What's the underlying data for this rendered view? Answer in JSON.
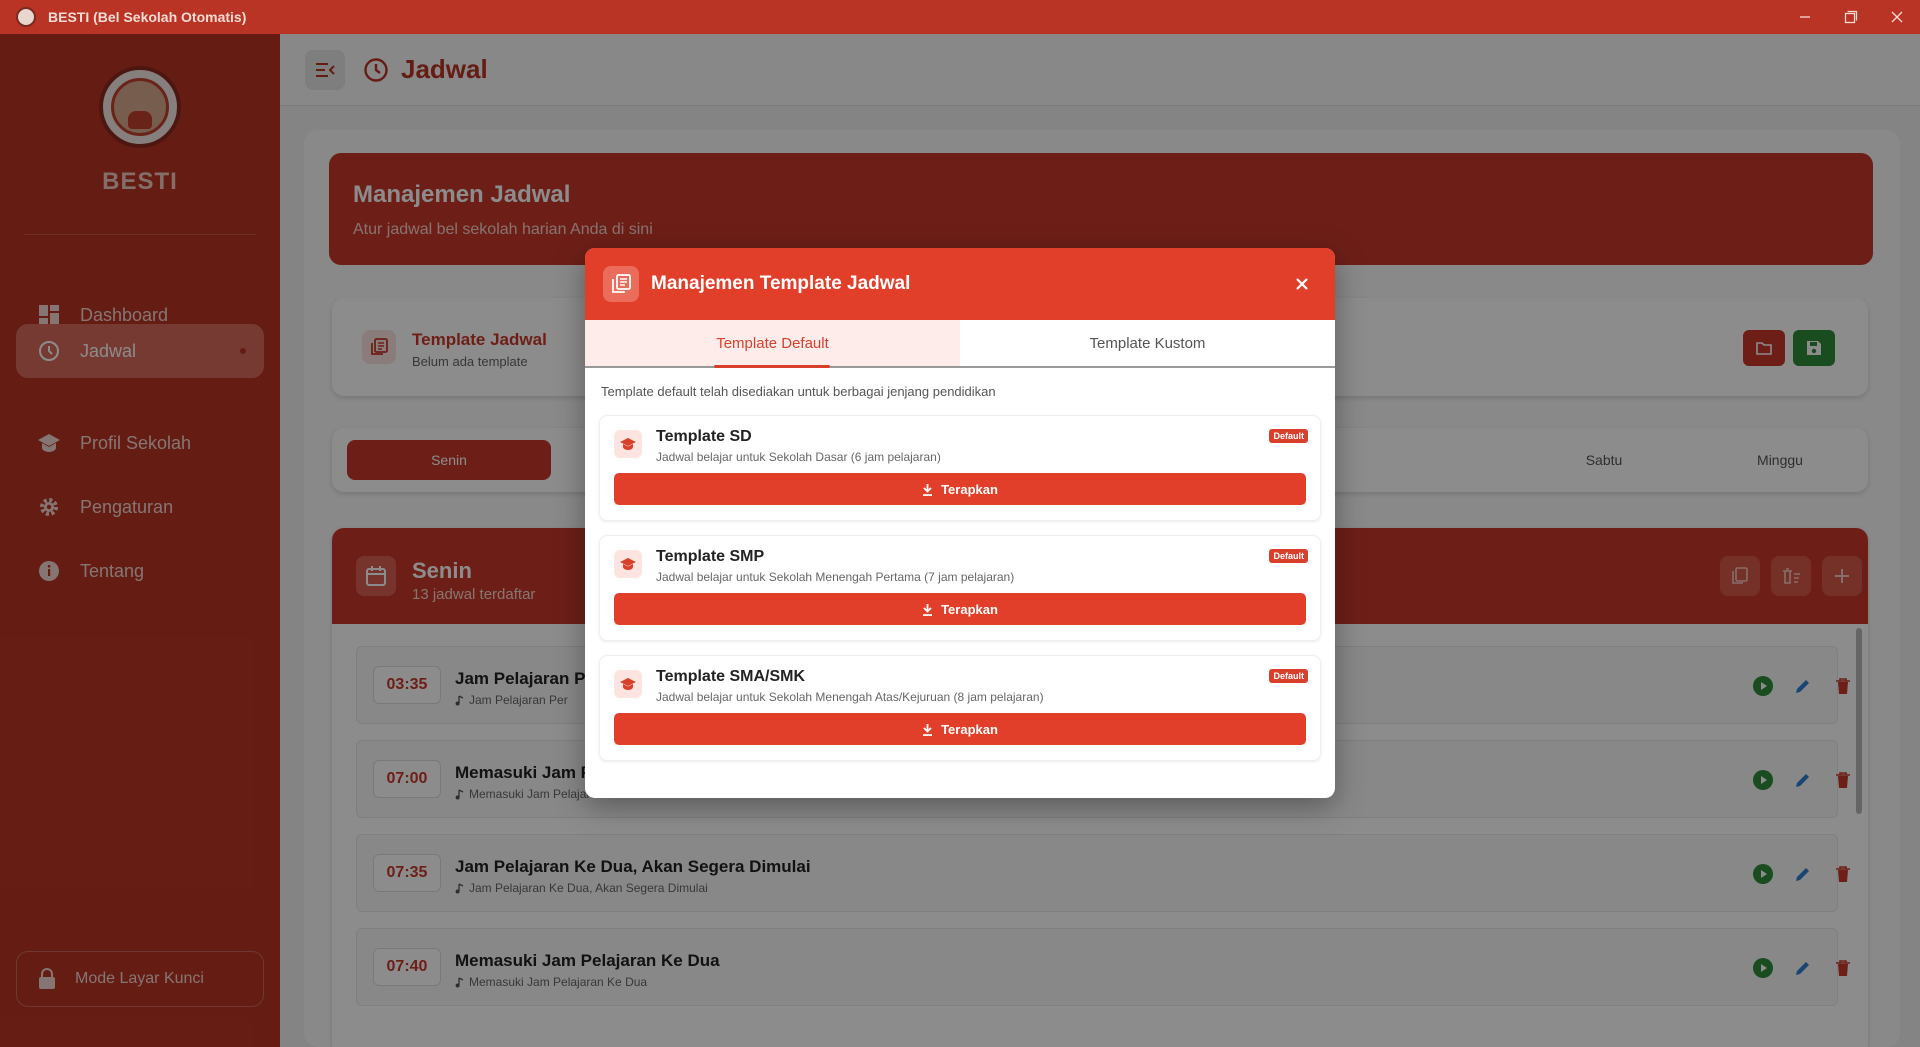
{
  "window": {
    "title": "BESTI (Bel Sekolah Otomatis)"
  },
  "sidebar": {
    "brand": "BESTI",
    "items": [
      {
        "label": "Dashboard",
        "icon": "dashboard-icon"
      },
      {
        "label": "Jadwal",
        "icon": "clock-icon",
        "active": true
      },
      {
        "label": "Profil Sekolah",
        "icon": "school-icon"
      },
      {
        "label": "Pengaturan",
        "icon": "gear-icon"
      },
      {
        "label": "Tentang",
        "icon": "info-icon"
      }
    ],
    "lock_label": "Mode Layar Kunci"
  },
  "topbar": {
    "title": "Jadwal"
  },
  "hero": {
    "title": "Manajemen Jadwal",
    "subtitle": "Atur jadwal bel sekolah harian Anda di sini"
  },
  "template_card": {
    "title": "Template Jadwal",
    "subtitle": "Belum ada template"
  },
  "days": {
    "items": [
      "Senin",
      "Sabtu",
      "Minggu"
    ],
    "active": "Senin"
  },
  "schedule": {
    "day": "Senin",
    "count_label": "13 jadwal terdaftar",
    "rows": [
      {
        "time": "03:35",
        "title": "Jam Pelajaran Pe",
        "subtitle": "Jam Pelajaran Per"
      },
      {
        "time": "07:00",
        "title": "Memasuki Jam P",
        "subtitle": "Memasuki Jam Pelajaran Pertama"
      },
      {
        "time": "07:35",
        "title": "Jam Pelajaran Ke Dua, Akan Segera Dimulai",
        "subtitle": "Jam Pelajaran Ke Dua, Akan Segera Dimulai"
      },
      {
        "time": "07:40",
        "title": "Memasuki Jam Pelajaran Ke Dua",
        "subtitle": "Memasuki Jam Pelajaran Ke Dua"
      }
    ]
  },
  "modal": {
    "title": "Manajemen Template Jadwal",
    "tabs": [
      "Template Default",
      "Template Kustom"
    ],
    "active_tab": "Template Default",
    "description": "Template default telah disediakan untuk berbagai jenjang pendidikan",
    "templates": [
      {
        "title": "Template SD",
        "description": "Jadwal belajar untuk Sekolah Dasar (6 jam pelajaran)",
        "badge": "Default",
        "button": "Terapkan"
      },
      {
        "title": "Template SMP",
        "description": "Jadwal belajar untuk Sekolah Menengah Pertama (7 jam pelajaran)",
        "badge": "Default",
        "button": "Terapkan"
      },
      {
        "title": "Template SMA/SMK",
        "description": "Jadwal belajar untuk Sekolah Menengah Atas/Kejuruan (8 jam pelajaran)",
        "badge": "Default",
        "button": "Terapkan"
      }
    ]
  },
  "colors": {
    "brand_red": "#c63a2a",
    "modal_red": "#e13f2a",
    "success_green": "#2e8b3a",
    "edit_blue": "#2f7fd1"
  }
}
